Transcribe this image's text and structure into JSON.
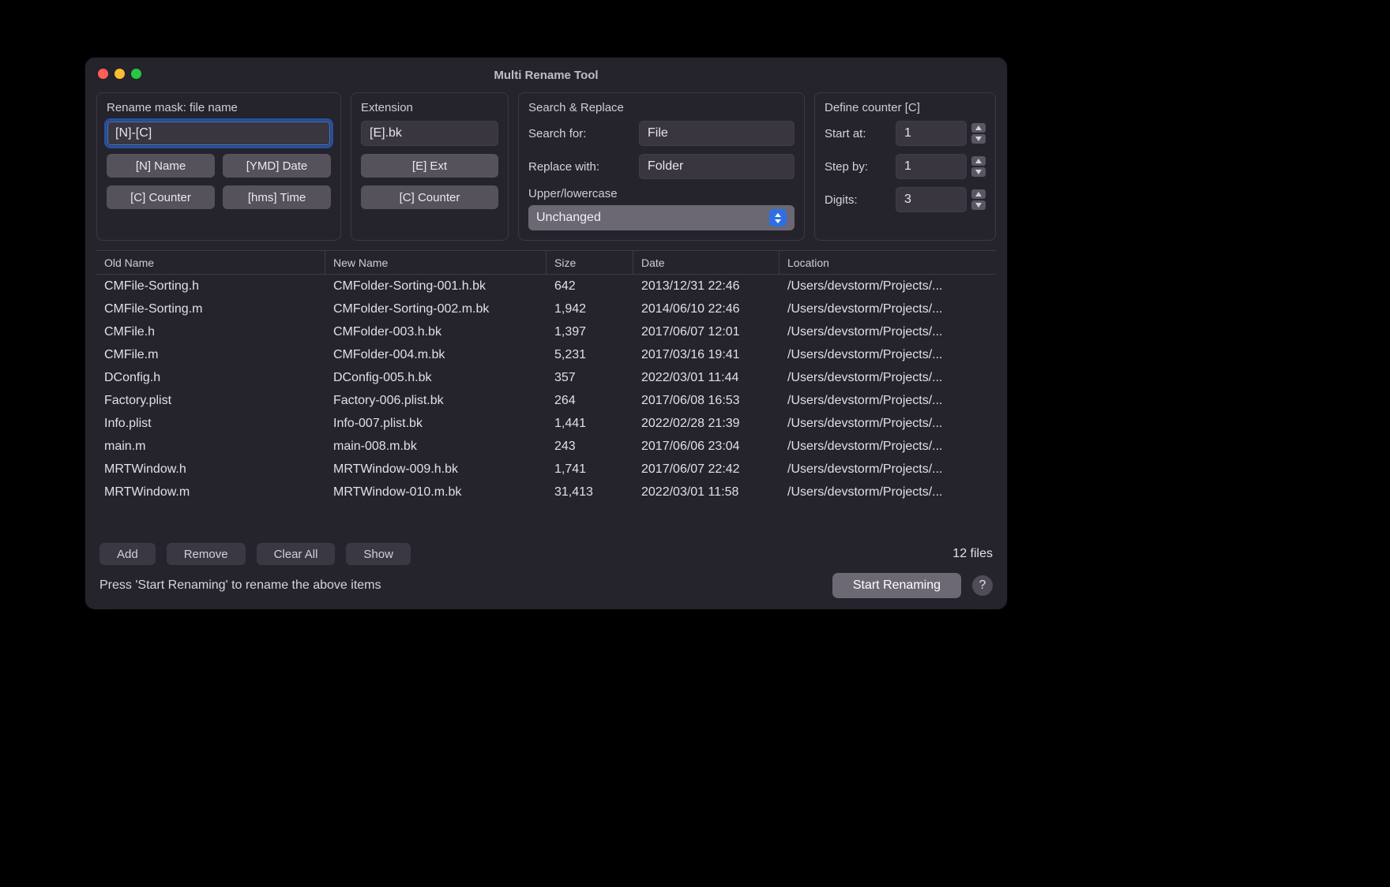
{
  "window": {
    "title": "Multi Rename Tool"
  },
  "mask": {
    "title": "Rename mask: file name",
    "value": "[N]-[C]",
    "btn_name": "[N] Name",
    "btn_date": "[YMD] Date",
    "btn_counter": "[C] Counter",
    "btn_time": "[hms] Time"
  },
  "ext": {
    "title": "Extension",
    "value": "[E].bk",
    "btn_ext": "[E] Ext",
    "btn_counter": "[C] Counter"
  },
  "sr": {
    "title": "Search & Replace",
    "search_label": "Search for:",
    "search_value": "File",
    "replace_label": "Replace with:",
    "replace_value": "Folder",
    "case_title": "Upper/lowercase",
    "case_value": "Unchanged"
  },
  "counter": {
    "title": "Define counter [C]",
    "start_label": "Start at:",
    "start_value": "1",
    "step_label": "Step by:",
    "step_value": "1",
    "digits_label": "Digits:",
    "digits_value": "3"
  },
  "table": {
    "cols": {
      "old": "Old Name",
      "new": "New Name",
      "size": "Size",
      "date": "Date",
      "loc": "Location"
    },
    "rows": [
      {
        "old": "CMFile-Sorting.h",
        "new": "CMFolder-Sorting-001.h.bk",
        "size": "642",
        "date": "2013/12/31 22:46",
        "loc": "/Users/devstorm/Projects/..."
      },
      {
        "old": "CMFile-Sorting.m",
        "new": "CMFolder-Sorting-002.m.bk",
        "size": "1,942",
        "date": "2014/06/10 22:46",
        "loc": "/Users/devstorm/Projects/..."
      },
      {
        "old": "CMFile.h",
        "new": "CMFolder-003.h.bk",
        "size": "1,397",
        "date": "2017/06/07 12:01",
        "loc": "/Users/devstorm/Projects/..."
      },
      {
        "old": "CMFile.m",
        "new": "CMFolder-004.m.bk",
        "size": "5,231",
        "date": "2017/03/16 19:41",
        "loc": "/Users/devstorm/Projects/..."
      },
      {
        "old": "DConfig.h",
        "new": "DConfig-005.h.bk",
        "size": "357",
        "date": "2022/03/01 11:44",
        "loc": "/Users/devstorm/Projects/..."
      },
      {
        "old": "Factory.plist",
        "new": "Factory-006.plist.bk",
        "size": "264",
        "date": "2017/06/08 16:53",
        "loc": "/Users/devstorm/Projects/..."
      },
      {
        "old": "Info.plist",
        "new": "Info-007.plist.bk",
        "size": "1,441",
        "date": "2022/02/28 21:39",
        "loc": "/Users/devstorm/Projects/..."
      },
      {
        "old": "main.m",
        "new": "main-008.m.bk",
        "size": "243",
        "date": "2017/06/06 23:04",
        "loc": "/Users/devstorm/Projects/..."
      },
      {
        "old": "MRTWindow.h",
        "new": "MRTWindow-009.h.bk",
        "size": "1,741",
        "date": "2017/06/07 22:42",
        "loc": "/Users/devstorm/Projects/..."
      },
      {
        "old": "MRTWindow.m",
        "new": "MRTWindow-010.m.bk",
        "size": "31,413",
        "date": "2022/03/01 11:58",
        "loc": "/Users/devstorm/Projects/..."
      }
    ]
  },
  "actions": {
    "add": "Add",
    "remove": "Remove",
    "clear": "Clear All",
    "show": "Show",
    "count": "12 files",
    "hint": "Press 'Start Renaming' to rename the above items",
    "start": "Start Renaming",
    "help": "?"
  }
}
